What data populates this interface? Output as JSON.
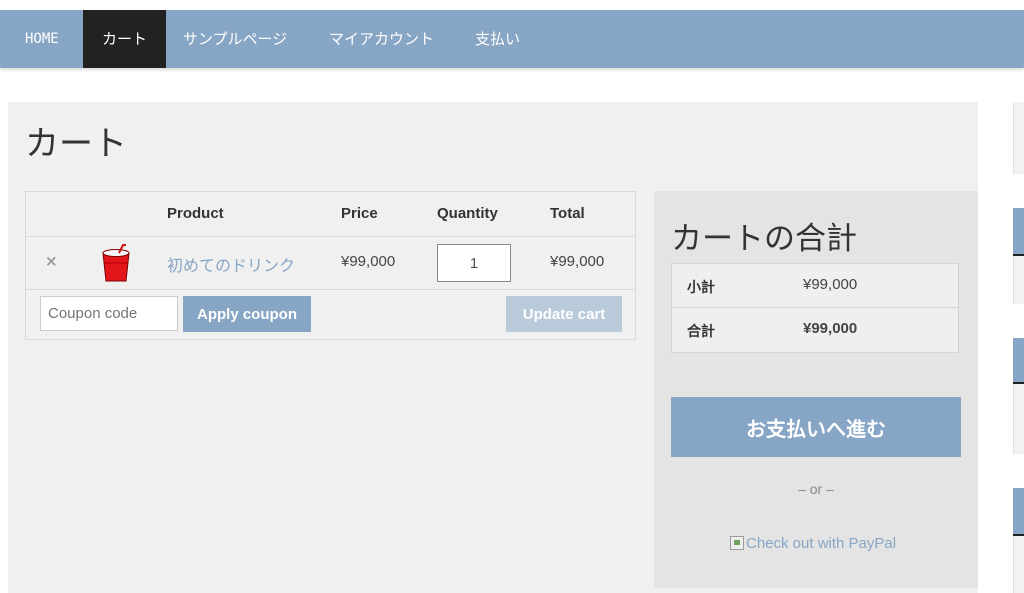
{
  "nav": {
    "items": [
      {
        "label": "HOME",
        "active": false
      },
      {
        "label": "カート",
        "active": true
      },
      {
        "label": "サンプルページ",
        "active": false
      },
      {
        "label": "マイアカウント",
        "active": false
      },
      {
        "label": "支払い",
        "active": false
      }
    ]
  },
  "page": {
    "title": "カート"
  },
  "cart": {
    "headers": {
      "product": "Product",
      "price": "Price",
      "quantity": "Quantity",
      "total": "Total"
    },
    "items": [
      {
        "remove": "×",
        "image_icon": "red-cup-icon",
        "product": "初めてのドリンク",
        "price": "¥99,000",
        "quantity": "1",
        "total": "¥99,000"
      }
    ],
    "coupon_placeholder": "Coupon code",
    "apply_coupon": "Apply coupon",
    "update_cart": "Update cart"
  },
  "totals": {
    "title": "カートの合計",
    "subtotal_label": "小計",
    "subtotal_value": "¥99,000",
    "total_label": "合計",
    "total_value": "¥99,000",
    "checkout_button": "お支払いへ進む",
    "or": "– or –",
    "paypal_alt": "Check out with PayPal"
  },
  "colors": {
    "accent": "#87a5c4",
    "nav_active": "#222222",
    "panel": "#f0f0f0",
    "totals_panel": "#e4e4e4"
  }
}
